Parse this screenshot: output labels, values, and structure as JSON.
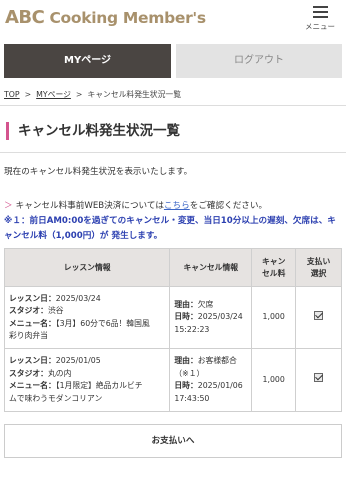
{
  "header": {
    "logo_abc": "ABC",
    "logo_rest": " Cooking Member's",
    "menu_label": "メニュー"
  },
  "nav": {
    "my_page": "MYページ",
    "logout": "ログアウト"
  },
  "breadcrumb": {
    "top": "TOP",
    "sep1": ">",
    "mypage": "MYページ",
    "sep2": ">",
    "current": "キャンセル料発生状況一覧"
  },
  "page_title": "キャンセル料発生状況一覧",
  "intro": "現在のキャンセル料発生状況を表示いたします。",
  "note": {
    "arrow": "＞",
    "prefix": "キャンセル料事前WEB決済については",
    "link": "こちら",
    "suffix": "をご確認ください。"
  },
  "warning": "※１：前日AM0:00を過ぎてのキャンセル・変更、当日10分以上の遅刻、欠席は、キャンセル料（1,000円）が 発生します。",
  "table": {
    "headers": {
      "lesson": "レッスン情報",
      "cancel": "キャンセル情報",
      "fee_1": "キャン",
      "fee_2": "セル料",
      "payment_1": "支払い",
      "payment_2": "選択"
    },
    "label_lesson_date": "レッスン日：",
    "label_studio": "スタジオ：",
    "label_menu": "メニュー名：",
    "label_reason": "理由：",
    "label_datetime": "日時：",
    "rows": [
      {
        "lesson_date": "2025/03/24",
        "studio": "渋谷",
        "menu_1": "【3月】60分で6品！韓国風",
        "menu_2": "彩り肉弁当",
        "reason_1": "欠席",
        "reason_2": "",
        "datetime_1": "2025/03/24",
        "datetime_2": "15:22:23",
        "fee": "1,000",
        "checked": true
      },
      {
        "lesson_date": "2025/01/05",
        "studio": "丸の内",
        "menu_1": "【1月限定】絶品カルビチ",
        "menu_2": "ムで味わうモダンコリアン",
        "reason_1": "お客様都合",
        "reason_2": "（※１）",
        "datetime_1": "2025/01/06",
        "datetime_2": "17:43:50",
        "fee": "1,000",
        "checked": true
      }
    ]
  },
  "pay_button": "お支払いへ",
  "colors": {
    "brand_gold": "#a8916c",
    "accent_pink": "#d4548e",
    "tab_dark": "#4a4542",
    "warning_blue": "#2b3fb0",
    "link_blue": "#3c66c6"
  }
}
